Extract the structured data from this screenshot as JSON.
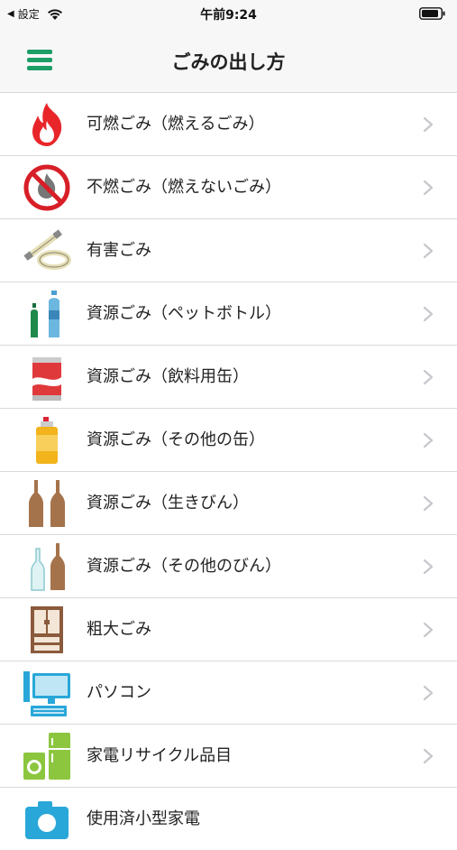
{
  "status_bar": {
    "back_label": "設定",
    "time": "午前9:24"
  },
  "header": {
    "title": "ごみの出し方",
    "menu_icon": "hamburger-menu-icon"
  },
  "items": [
    {
      "label": "可燃ごみ（燃えるごみ）",
      "icon": "burnable-fire-icon"
    },
    {
      "label": "不燃ごみ（燃えないごみ）",
      "icon": "non-burnable-icon"
    },
    {
      "label": "有害ごみ",
      "icon": "fluorescent-tube-icon"
    },
    {
      "label": "資源ごみ（ペットボトル）",
      "icon": "pet-bottle-icon"
    },
    {
      "label": "資源ごみ（飲料用缶）",
      "icon": "drink-can-icon"
    },
    {
      "label": "資源ごみ（その他の缶）",
      "icon": "spray-can-icon"
    },
    {
      "label": "資源ごみ（生きびん）",
      "icon": "returnable-bottle-icon"
    },
    {
      "label": "資源ごみ（その他のびん）",
      "icon": "other-bottle-icon"
    },
    {
      "label": "粗大ごみ",
      "icon": "cabinet-icon"
    },
    {
      "label": "パソコン",
      "icon": "computer-icon"
    },
    {
      "label": "家電リサイクル品目",
      "icon": "appliance-icon"
    },
    {
      "label": "使用済小型家電",
      "icon": "camera-icon"
    }
  ],
  "colors": {
    "accent": "#1d9e67",
    "chevron": "#c7c7cc",
    "divider": "#d9d9d9"
  }
}
